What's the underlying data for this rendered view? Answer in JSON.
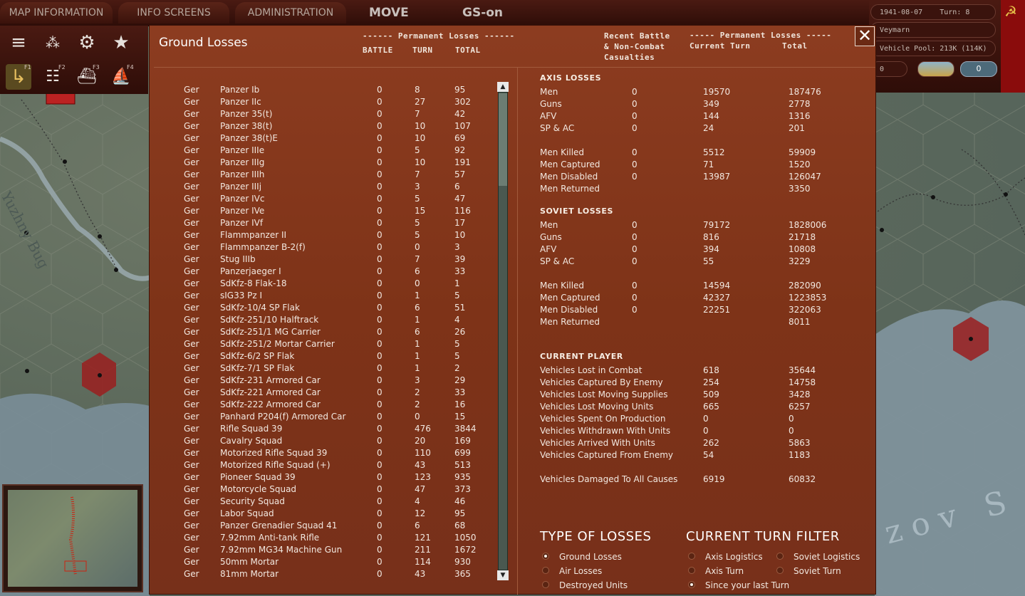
{
  "topbar": {
    "tabs": [
      "MAP INFORMATION",
      "INFO SCREENS",
      "ADMINISTRATION"
    ],
    "mode": "MOVE",
    "gs_status": "GS-on"
  },
  "info": {
    "date": "1941-08-07",
    "turn": "Turn: 8",
    "location": "Veymarn",
    "vehicle_pool": "Vehicle Pool: 213K (114K)",
    "field_value": "0"
  },
  "map": {
    "river_label": "Yuzhny Bug",
    "sea_label": "zov S"
  },
  "toolbar": {
    "fkeys": [
      "F1",
      "F2",
      "F3",
      "F4"
    ]
  },
  "dialog": {
    "title": "Ground Losses",
    "perm_header_left": "------ Permanent Losses ------",
    "col_battle": "BATTLE",
    "col_turn": "TURN",
    "col_total": "TOTAL",
    "recent_header": "Recent Battle\n& Non-Combat\nCasualties",
    "perm_header_right": "----- Permanent Losses -----",
    "col_current_turn": "Current Turn",
    "col_total_right": "Total",
    "close_glyph": "✕"
  },
  "units": [
    [
      "Ger",
      "Panzer Ib",
      "0",
      "8",
      "95"
    ],
    [
      "Ger",
      "Panzer IIc",
      "0",
      "27",
      "302"
    ],
    [
      "Ger",
      "Panzer 35(t)",
      "0",
      "7",
      "42"
    ],
    [
      "Ger",
      "Panzer 38(t)",
      "0",
      "10",
      "107"
    ],
    [
      "Ger",
      "Panzer 38(t)E",
      "0",
      "10",
      "69"
    ],
    [
      "Ger",
      "Panzer IIIe",
      "0",
      "5",
      "92"
    ],
    [
      "Ger",
      "Panzer IIIg",
      "0",
      "10",
      "191"
    ],
    [
      "Ger",
      "Panzer IIIh",
      "0",
      "7",
      "57"
    ],
    [
      "Ger",
      "Panzer IIIj",
      "0",
      "3",
      "6"
    ],
    [
      "Ger",
      "Panzer IVc",
      "0",
      "5",
      "47"
    ],
    [
      "Ger",
      "Panzer IVe",
      "0",
      "15",
      "116"
    ],
    [
      "Ger",
      "Panzer IVf",
      "0",
      "5",
      "17"
    ],
    [
      "Ger",
      "Flammpanzer II",
      "0",
      "5",
      "10"
    ],
    [
      "Ger",
      "Flammpanzer B-2(f)",
      "0",
      "0",
      "3"
    ],
    [
      "Ger",
      "Stug IIIb",
      "0",
      "7",
      "39"
    ],
    [
      "Ger",
      "Panzerjaeger I",
      "0",
      "6",
      "33"
    ],
    [
      "Ger",
      "SdKfz-8 Flak-18",
      "0",
      "0",
      "1"
    ],
    [
      "Ger",
      "sIG33 Pz I",
      "0",
      "1",
      "5"
    ],
    [
      "Ger",
      "SdKfz-10/4 SP Flak",
      "0",
      "6",
      "51"
    ],
    [
      "Ger",
      "SdKfz-251/10 Halftrack",
      "0",
      "1",
      "4"
    ],
    [
      "Ger",
      "SdKfz-251/1 MG Carrier",
      "0",
      "6",
      "26"
    ],
    [
      "Ger",
      "SdKfz-251/2 Mortar Carrier",
      "0",
      "1",
      "5"
    ],
    [
      "Ger",
      "SdKfz-6/2 SP Flak",
      "0",
      "1",
      "5"
    ],
    [
      "Ger",
      "SdKfz-7/1 SP Flak",
      "0",
      "1",
      "2"
    ],
    [
      "Ger",
      "SdKfz-231 Armored Car",
      "0",
      "3",
      "29"
    ],
    [
      "Ger",
      "SdKfz-221 Armored Car",
      "0",
      "2",
      "33"
    ],
    [
      "Ger",
      "SdKfz-222 Armored Car",
      "0",
      "2",
      "16"
    ],
    [
      "Ger",
      "Panhard P204(f) Armored Car",
      "0",
      "0",
      "15"
    ],
    [
      "Ger",
      "Rifle Squad 39",
      "0",
      "476",
      "3844"
    ],
    [
      "Ger",
      "Cavalry Squad",
      "0",
      "20",
      "169"
    ],
    [
      "Ger",
      "Motorized Rifle Squad 39",
      "0",
      "110",
      "699"
    ],
    [
      "Ger",
      "Motorized Rifle Squad (+)",
      "0",
      "43",
      "513"
    ],
    [
      "Ger",
      "Pioneer Squad 39",
      "0",
      "123",
      "935"
    ],
    [
      "Ger",
      "Motorcycle Squad",
      "0",
      "47",
      "373"
    ],
    [
      "Ger",
      "Security Squad",
      "0",
      "4",
      "46"
    ],
    [
      "Ger",
      "Labor Squad",
      "0",
      "12",
      "95"
    ],
    [
      "Ger",
      "Panzer Grenadier Squad 41",
      "0",
      "6",
      "68"
    ],
    [
      "Ger",
      "7.92mm Anti-tank Rifle",
      "0",
      "121",
      "1050"
    ],
    [
      "Ger",
      "7.92mm MG34 Machine Gun",
      "0",
      "211",
      "1672"
    ],
    [
      "Ger",
      "50mm Mortar",
      "0",
      "114",
      "930"
    ],
    [
      "Ger",
      "81mm Mortar",
      "0",
      "43",
      "365"
    ]
  ],
  "axis": {
    "title": "AXIS LOSSES",
    "rows": [
      [
        "Men",
        "0",
        "19570",
        "187476"
      ],
      [
        "Guns",
        "0",
        "349",
        "2778"
      ],
      [
        "AFV",
        "0",
        "144",
        "1316"
      ],
      [
        "SP & AC",
        "0",
        "24",
        "201"
      ],
      [
        "Men Killed",
        "0",
        "5512",
        "59909"
      ],
      [
        "Men Captured",
        "0",
        "71",
        "1520"
      ],
      [
        "Men Disabled",
        "0",
        "13987",
        "126047"
      ],
      [
        "Men Returned",
        "",
        "",
        "3350"
      ]
    ]
  },
  "soviet": {
    "title": "SOVIET LOSSES",
    "rows": [
      [
        "Men",
        "0",
        "79172",
        "1828006"
      ],
      [
        "Guns",
        "0",
        "816",
        "21718"
      ],
      [
        "AFV",
        "0",
        "394",
        "10808"
      ],
      [
        "SP & AC",
        "0",
        "55",
        "3229"
      ],
      [
        "Men Killed",
        "0",
        "14594",
        "282090"
      ],
      [
        "Men Captured",
        "0",
        "42327",
        "1223853"
      ],
      [
        "Men Disabled",
        "0",
        "22251",
        "322063"
      ],
      [
        "Men Returned",
        "",
        "",
        "8011"
      ]
    ]
  },
  "player": {
    "title": "CURRENT PLAYER",
    "rows": [
      [
        "Vehicles Lost in Combat",
        "618",
        "35644"
      ],
      [
        "Vehicles Captured By Enemy",
        "254",
        "14758"
      ],
      [
        "Vehicles Lost Moving Supplies",
        "509",
        "3428"
      ],
      [
        "Vehicles Lost Moving Units",
        "665",
        "6257"
      ],
      [
        "Vehicles Spent On Production",
        "0",
        "0"
      ],
      [
        "Vehicles Withdrawn With Units",
        "0",
        "0"
      ],
      [
        "Vehicles Arrived With Units",
        "262",
        "5863"
      ],
      [
        "Vehicles Captured From Enemy",
        "54",
        "1183"
      ],
      [
        "Vehicles Damaged To All Causes",
        "6919",
        "60832"
      ]
    ]
  },
  "type_of_losses": {
    "title": "TYPE OF LOSSES",
    "options": [
      "Ground Losses",
      "Air Losses",
      "Destroyed Units"
    ],
    "selected": 0
  },
  "turn_filter": {
    "title": "CURRENT TURN FILTER",
    "options": [
      "Axis Logistics",
      "Soviet Logistics",
      "Axis Turn",
      "Soviet Turn",
      "Since your last Turn"
    ],
    "selected": 4
  }
}
